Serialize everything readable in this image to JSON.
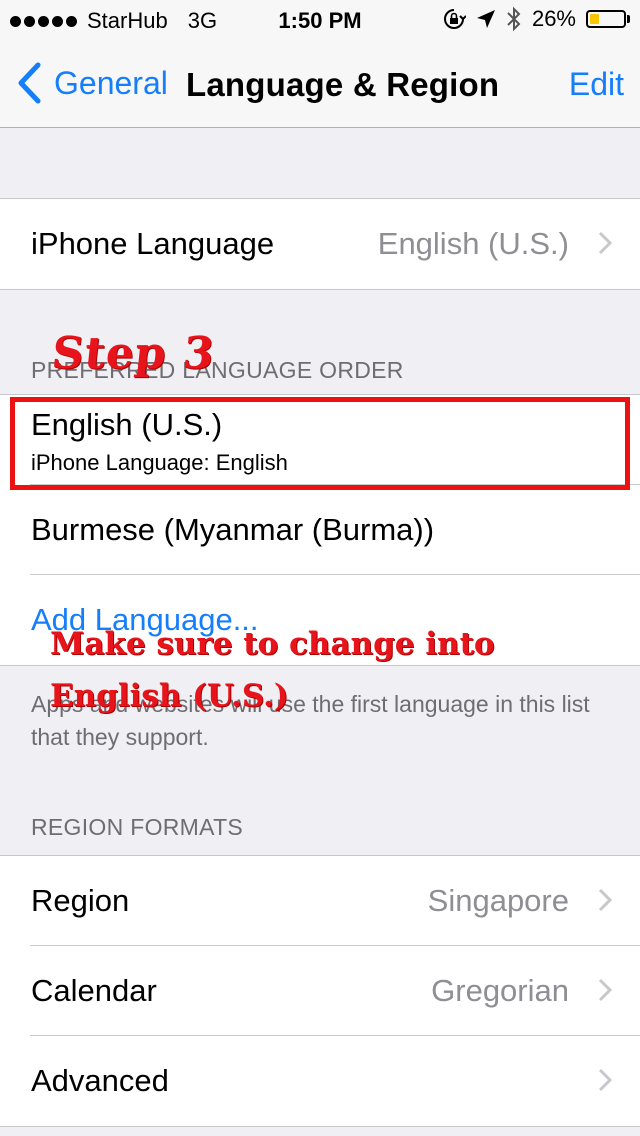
{
  "status_bar": {
    "carrier": "StarHub",
    "network": "3G",
    "time": "1:50 PM",
    "battery": "26%",
    "battery_level": 0.26
  },
  "nav": {
    "back_label": "General",
    "title": "Language & Region",
    "edit_label": "Edit"
  },
  "iphone_language": {
    "label": "iPhone Language",
    "value": "English (U.S.)"
  },
  "preferred_order": {
    "header": "PREFERRED LANGUAGE ORDER",
    "items": [
      {
        "title": "English (U.S.)",
        "subtitle": "iPhone Language: English"
      },
      {
        "title": "Burmese (Myanmar (Burma))"
      }
    ],
    "add_language": "Add Language...",
    "footer": "Apps and websites will use the first language in this list that they support."
  },
  "region_formats": {
    "header": "REGION FORMATS",
    "rows": [
      {
        "label": "Region",
        "value": "Singapore"
      },
      {
        "label": "Calendar",
        "value": "Gregorian"
      },
      {
        "label": "Advanced",
        "value": ""
      }
    ]
  },
  "annotations": {
    "step": "Step 3",
    "note_line1": "Make sure to change into",
    "note_line2": "English (U.S.)",
    "highlight_color": "#ee1111"
  },
  "colors": {
    "accent": "#147efb",
    "background": "#efeff4",
    "secondary_text": "#8e8e93"
  }
}
